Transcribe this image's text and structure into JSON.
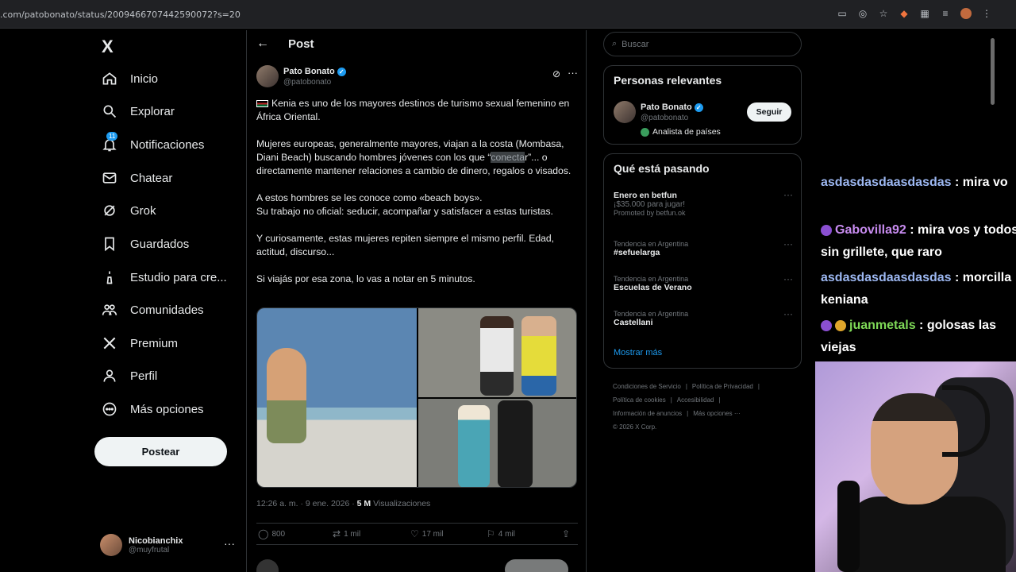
{
  "browser": {
    "url": ".com/patobonato/status/2009466707442590072?s=20"
  },
  "sidebar": {
    "logo": "X",
    "items": [
      {
        "label": "Inicio"
      },
      {
        "label": "Explorar"
      },
      {
        "label": "Notificaciones",
        "badge": "11"
      },
      {
        "label": "Chatear"
      },
      {
        "label": "Grok"
      },
      {
        "label": "Guardados"
      },
      {
        "label": "Estudio para cre..."
      },
      {
        "label": "Comunidades"
      },
      {
        "label": "Premium"
      },
      {
        "label": "Perfil"
      },
      {
        "label": "Más opciones"
      }
    ],
    "post_button": "Postear",
    "account": {
      "name": "Nicobianchix",
      "handle": "@muyfrutal"
    }
  },
  "main": {
    "header_title": "Post",
    "author": {
      "name": "Pato Bonato",
      "handle": "@patobonato"
    },
    "text": {
      "p1": "Kenia es uno de los mayores destinos de turismo sexual femenino en África Oriental.",
      "p2a": "Mujeres europeas, generalmente mayores, viajan a la costa (Mombasa, Diani Beach) buscando hombres jóvenes con los que “",
      "p2hl": "conecta",
      "p2b": "r”... o directamente mantener relaciones a cambio de dinero, regalos o visados.",
      "p3a": "A estos hombres se les conoce como «beach boys».",
      "p3b": "Su trabajo no oficial: seducir, acompañar y satisfacer a estas turistas.",
      "p4": "Y curiosamente, estas mujeres repiten siempre el mismo perfil. Edad, actitud, discurso...",
      "p5": "Si viajás por esa zona, lo vas a notar en 5 minutos."
    },
    "timestamp": "12:26 a. m. · 9 ene. 2026 · ",
    "views_count": "5 M",
    "views_label": " Visualizaciones",
    "actions": {
      "replies": "800",
      "reposts": "1 mil",
      "likes": "17 mil",
      "bookmarks": "4 mil"
    }
  },
  "right": {
    "search_placeholder": "Buscar",
    "relevant": {
      "title": "Personas relevantes",
      "name": "Pato Bonato",
      "handle": "@patobonato",
      "desc": "Analista de países",
      "follow": "Seguir"
    },
    "trending": {
      "title": "Qué está pasando",
      "items": [
        {
          "name": "Enero en betfun",
          "sub": "¡$35.000 para jugar!",
          "promo": "Promoted by betfun.ok"
        },
        {
          "ctx": "Tendencia en Argentina",
          "name": "#sefuelarga"
        },
        {
          "ctx": "Tendencia en Argentina",
          "name": "Escuelas de Verano"
        },
        {
          "ctx": "Tendencia en Argentina",
          "name": "Castellani"
        }
      ],
      "show_more": "Mostrar más"
    },
    "footer": {
      "l1": "Condiciones de Servicio",
      "l2": "Política de Privacidad",
      "l3": "Política de cookies",
      "l4": "Accesibilidad",
      "l5": "Información de anuncios",
      "l6": "Más opciones ···",
      "l7": "© 2026 X Corp."
    }
  },
  "chat": [
    {
      "user": "asdasdasdaasdasdas",
      "text": " : mira vo"
    },
    {
      "user": "Gabovilla92",
      "text": " : mira vos y todos sin grillete, que raro"
    },
    {
      "user": "asdasdasdaasdasdas",
      "text": " : morcilla keniana"
    },
    {
      "user": "juanmetals",
      "text": " : golosas las viejas"
    }
  ]
}
